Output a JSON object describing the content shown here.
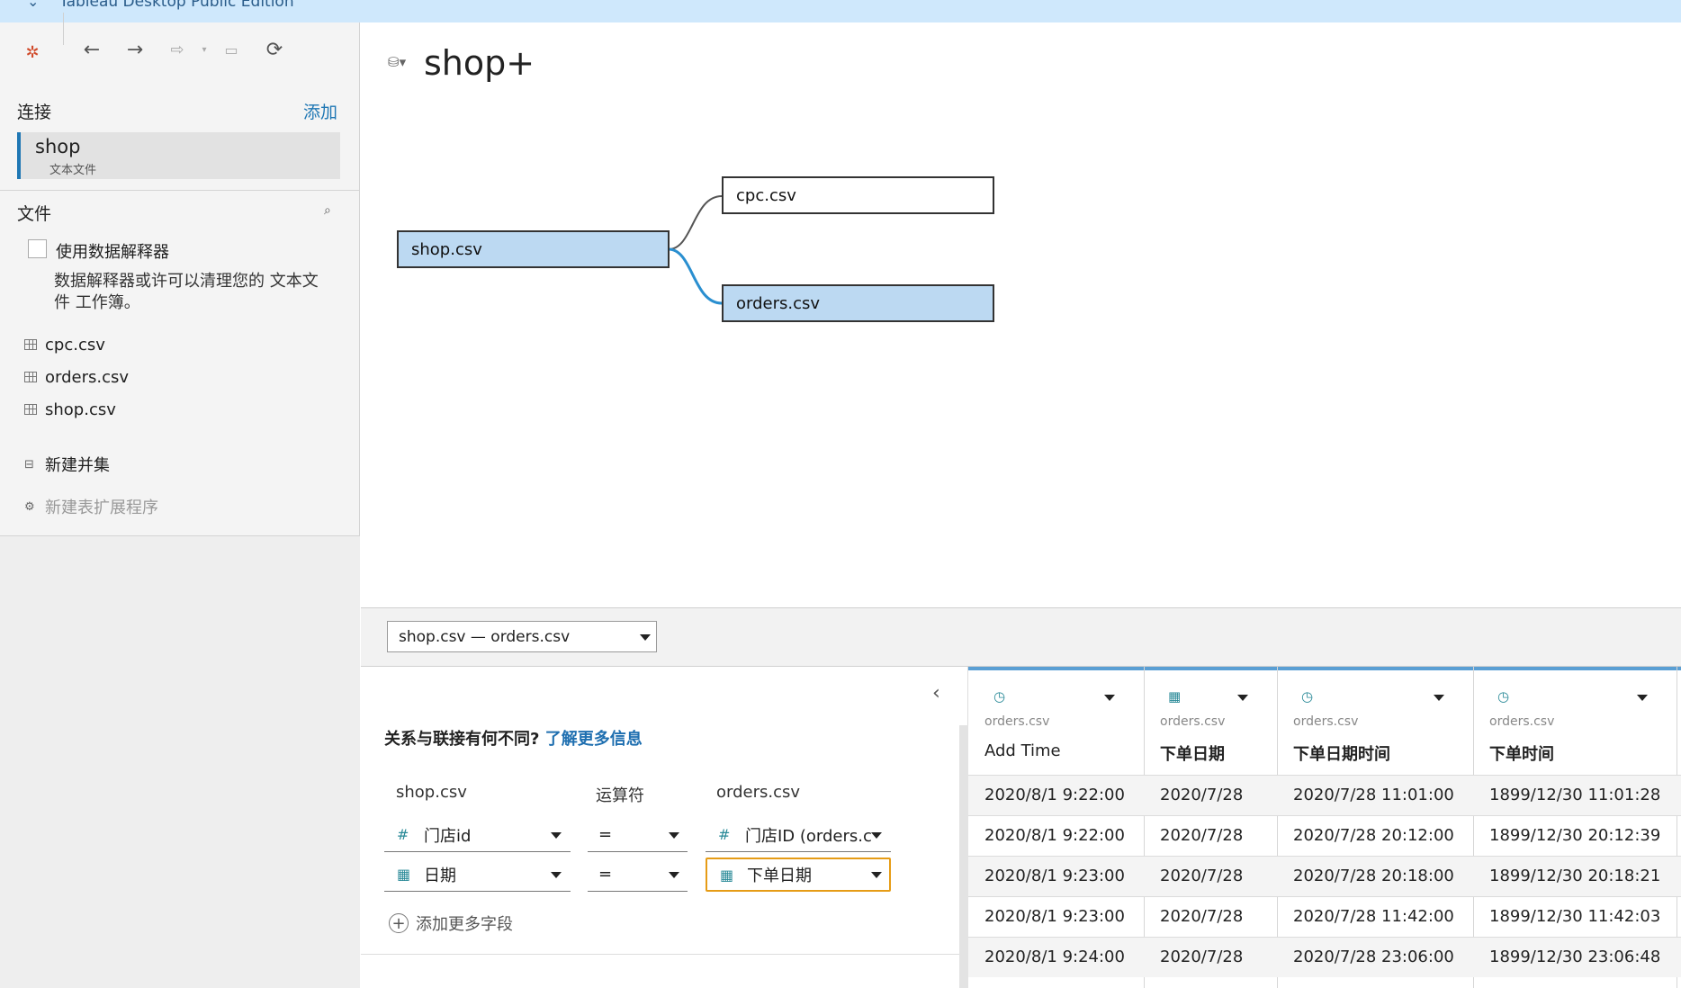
{
  "window": {
    "title": "Tableau Desktop Public Edition"
  },
  "toolbar": {
    "tableau_icon": "tableau-logo-icon",
    "back_icon": "arrow-left-icon",
    "forward_icon": "arrow-right-icon",
    "redo_icon": "redo-icon",
    "save_icon": "save-icon",
    "refresh_icon": "refresh-icon"
  },
  "connections": {
    "heading": "连接",
    "add_label": "添加",
    "items": [
      {
        "name": "shop",
        "type": "文本文件"
      }
    ]
  },
  "files": {
    "heading": "文件",
    "interpreter_label": "使用数据解释器",
    "interpreter_hint": "数据解释器或许可以清理您的 文本文件 工作簿。",
    "list": [
      "cpc.csv",
      "orders.csv",
      "shop.csv"
    ],
    "new_union": "新建并集",
    "new_extension": "新建表扩展程序"
  },
  "datasource": {
    "title": "shop+"
  },
  "canvas": {
    "tables": [
      "shop.csv",
      "cpc.csv",
      "orders.csv"
    ]
  },
  "relationship": {
    "selector_value": "shop.csv  —  orders.csv",
    "question": "关系与联接有何不同?",
    "learn_more": "了解更多信息",
    "left_header": "shop.csv",
    "operator_header": "运算符",
    "right_header": "orders.csv",
    "clauses": [
      {
        "left": "门店id",
        "op": "=",
        "right": "门店ID (orders.c",
        "type": "number"
      },
      {
        "left": "日期",
        "op": "=",
        "right": "下单日期",
        "type": "date"
      }
    ],
    "add_more": "添加更多字段"
  },
  "grid": {
    "columns": [
      {
        "source": "orders.csv",
        "name": "Add Time"
      },
      {
        "source": "orders.csv",
        "name": "下单日期"
      },
      {
        "source": "orders.csv",
        "name": "下单日期时间"
      },
      {
        "source": "orders.csv",
        "name": "下单时间"
      }
    ],
    "rows": [
      [
        "2020/8/1 9:22:00",
        "2020/7/28",
        "2020/7/28 11:01:00",
        "1899/12/30 11:01:28"
      ],
      [
        "2020/8/1 9:22:00",
        "2020/7/28",
        "2020/7/28 20:12:00",
        "1899/12/30 20:12:39"
      ],
      [
        "2020/8/1 9:23:00",
        "2020/7/28",
        "2020/7/28 20:18:00",
        "1899/12/30 20:18:21"
      ],
      [
        "2020/8/1 9:23:00",
        "2020/7/28",
        "2020/7/28 11:42:00",
        "1899/12/30 11:42:03"
      ],
      [
        "2020/8/1 9:24:00",
        "2020/7/28",
        "2020/7/28 23:06:00",
        "1899/12/30 23:06:48"
      ]
    ]
  },
  "colors": {
    "accent": "#1f77b4",
    "selected_table": "#bcd9f2",
    "highlight": "#e69c16"
  }
}
